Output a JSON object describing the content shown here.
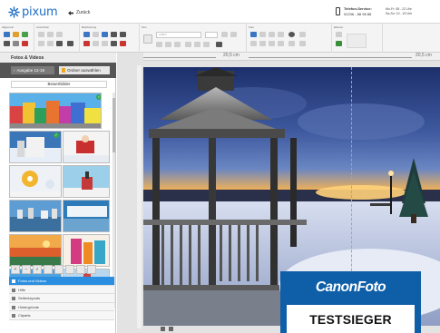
{
  "header": {
    "logo_text": "pixum",
    "back_label": "Zurück",
    "phone_label": "Telefon-Service:",
    "phone_number": "02236 - 88 98 88",
    "hours_line1": "Mo-Fr: 08 - 22 Uhr",
    "hours_line2": "Sa-So: 10 - 20 Uhr"
  },
  "toolbar": {
    "groups": [
      "Allgemein",
      "Ausrichten",
      "Bearbeitung",
      "Text",
      "Foto",
      "Ebenen"
    ],
    "font_value": "Calibri"
  },
  "left_panel": {
    "title": "Fotos & Videos",
    "tab_album": "Ausgabe 12-18",
    "tab_folder": "Ordner auswählen",
    "filter_label": "Bewertbilder",
    "menu": [
      {
        "label": "Fotos und Videos",
        "active": true
      },
      {
        "label": "Hilfe",
        "active": false
      },
      {
        "label": "Seitenlayouts",
        "active": false
      },
      {
        "label": "Hintergründe",
        "active": false
      },
      {
        "label": "Cliparts",
        "active": false
      }
    ]
  },
  "canvas": {
    "ruler_left": "20,5 cm",
    "ruler_right": "20,5 cm"
  },
  "badge": {
    "brand_main": "Canon",
    "brand_sub": "Foto",
    "title": "TESTSIEGER"
  },
  "colors": {
    "accent": "#1f6fc5",
    "menu_active": "#2a8fe0",
    "badge_blue": "#0f5fa8"
  }
}
